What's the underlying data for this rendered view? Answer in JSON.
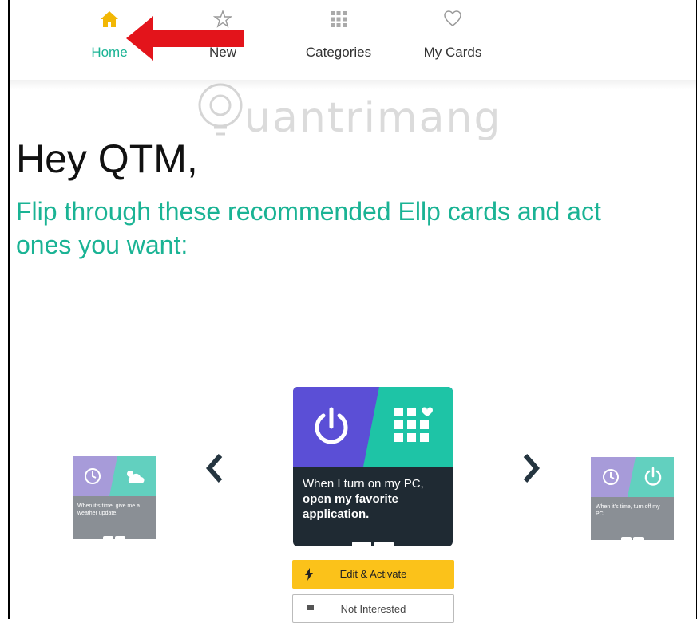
{
  "nav": {
    "items": [
      {
        "label": "Home",
        "icon": "home-icon",
        "active": true
      },
      {
        "label": "New",
        "icon": "star-icon",
        "active": false
      },
      {
        "label": "Categories",
        "icon": "grid-icon",
        "active": false
      },
      {
        "label": "My Cards",
        "icon": "heart-icon",
        "active": false
      }
    ]
  },
  "watermark": {
    "text": "uantrimang"
  },
  "greeting": "Hey QTM,",
  "subtitle_line1": "Flip through these recommended Ellp cards and act",
  "subtitle_line2": "ones you want:",
  "carousel": {
    "left_card": {
      "caption": "When it's time, give me a weather update."
    },
    "main_card": {
      "caption_plain": "When I turn on my PC,",
      "caption_bold": "open my favorite application."
    },
    "right_card": {
      "caption": "When it's time, turn off my PC."
    }
  },
  "actions": {
    "edit_label": "Edit & Activate",
    "not_interested_label": "Not Interested"
  },
  "colors": {
    "accent": "#1ab394",
    "purple": "#5b4fd6",
    "teal": "#1ec4a6",
    "yellow": "#fbc21a",
    "arrow": "#e3141b"
  }
}
